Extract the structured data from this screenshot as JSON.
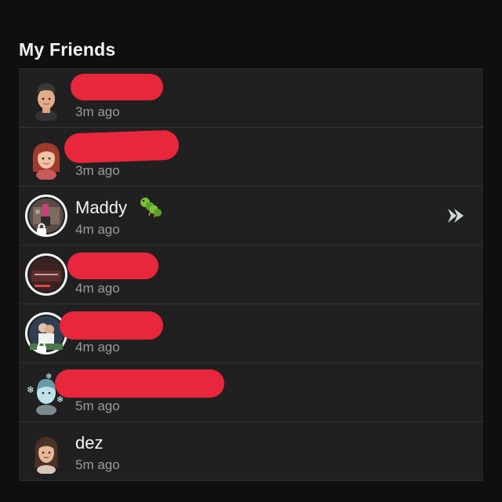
{
  "section": {
    "title": "My Friends"
  },
  "friends": [
    {
      "name": "",
      "time": "3m ago",
      "avatar": "bitmoji-beanie-icon",
      "redacted": true
    },
    {
      "name": "",
      "time": "3m ago",
      "avatar": "bitmoji-redhair-icon",
      "redacted": true
    },
    {
      "name": "Maddy",
      "time": "4m ago",
      "avatar": "story-ring-avatar-icon",
      "emoji": "caterpillar-icon",
      "action": "fast-forward-chat-icon",
      "locked": true
    },
    {
      "name": "",
      "time": "4m ago",
      "avatar": "story-ring-avatar-icon",
      "redacted": true
    },
    {
      "name": "",
      "time": "4m ago",
      "avatar": "story-ring-avatar-icon",
      "redacted": true,
      "locked": true
    },
    {
      "name": "",
      "time": "5m ago",
      "avatar": "bitmoji-snowflake-icon",
      "redacted": true
    },
    {
      "name": "dez",
      "time": "5m ago",
      "avatar": "bitmoji-longhair-icon"
    }
  ],
  "colors": {
    "background": "#0f0f0f",
    "list": "#202020",
    "redaction": "#e8263c",
    "muted": "#9a9a9a"
  }
}
